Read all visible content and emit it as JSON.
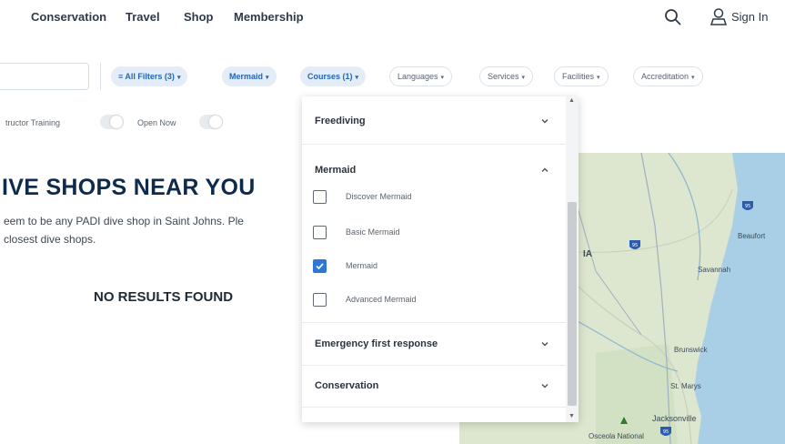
{
  "nav": {
    "links": [
      "Conservation",
      "Travel",
      "Shop",
      "Membership"
    ],
    "sign_in": "Sign In"
  },
  "filters": {
    "chips": [
      {
        "label": "≡ All Filters (3)",
        "active": true
      },
      {
        "label": "Mermaid",
        "active": true
      },
      {
        "label": "Courses (1)",
        "active": true
      },
      {
        "label": "Languages",
        "active": false
      },
      {
        "label": "Services",
        "active": false
      },
      {
        "label": "Facilities",
        "active": false
      },
      {
        "label": "Accreditation",
        "active": false
      }
    ],
    "caret": "▾"
  },
  "toggles": [
    {
      "label": "tructor Training",
      "on": false
    },
    {
      "label": "Open Now",
      "on": false
    }
  ],
  "results": {
    "heading": "IVE SHOPS NEAR YOU",
    "message_line1": "eem to be any PADI dive shop in Saint Johns. Ple",
    "message_line2": " closest dive shops.",
    "no_results": "NO RESULTS FOUND"
  },
  "map": {
    "labels": [
      "IA",
      "Beaufort",
      "Savannah",
      "Brunswick",
      "St. Marys",
      "Jacksonville",
      "Osceola National"
    ],
    "highway_shields": [
      "95",
      "95",
      "95"
    ]
  },
  "dropdown": {
    "sections": [
      {
        "title": "Freediving",
        "expanded": false
      },
      {
        "title": "Mermaid",
        "expanded": true,
        "options": [
          {
            "label": "Discover Mermaid",
            "checked": false
          },
          {
            "label": "Basic Mermaid",
            "checked": false
          },
          {
            "label": "Mermaid",
            "checked": true
          },
          {
            "label": "Advanced Mermaid",
            "checked": false
          }
        ]
      },
      {
        "title": "Emergency first response",
        "expanded": false
      },
      {
        "title": "Conservation",
        "expanded": false
      }
    ]
  },
  "colors": {
    "accent": "#2c78d4",
    "heading": "#0f2b4c",
    "chip_active_bg": "#e3ecf7"
  }
}
